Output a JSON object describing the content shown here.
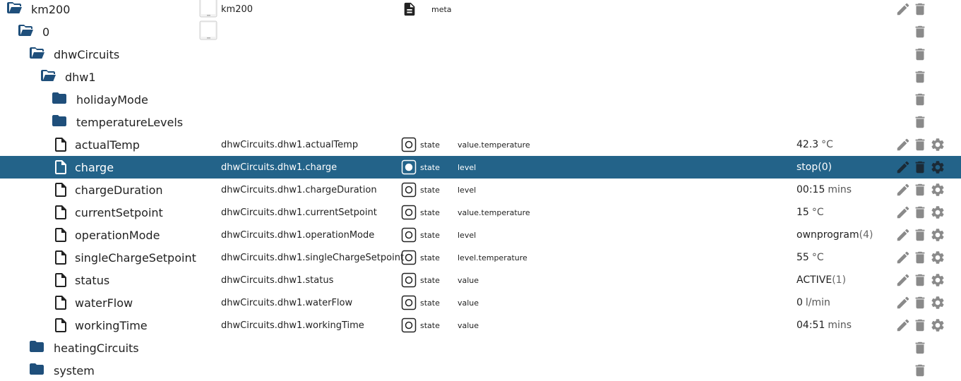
{
  "colors": {
    "folder": "#1f4f7b",
    "selected_bg": "#236389",
    "action_icon": "#8a8a8a"
  },
  "icons": {
    "folder_open": "folder-open-icon",
    "folder_closed": "folder-icon",
    "state": "file-icon",
    "edit": "pencil-icon",
    "delete": "trash-icon",
    "settings": "gear-icon",
    "meta": "document-icon"
  },
  "rows": [
    {
      "name": "km200",
      "kind": "folder-open",
      "id": "km200",
      "type": "meta",
      "role": "",
      "value": "",
      "unit": "",
      "code": ""
    },
    {
      "name": "0",
      "kind": "folder-open",
      "id": "",
      "type": "",
      "role": "",
      "value": "",
      "unit": "",
      "code": ""
    },
    {
      "name": "dhwCircuits",
      "kind": "folder-open",
      "id": "",
      "type": "",
      "role": "",
      "value": "",
      "unit": "",
      "code": ""
    },
    {
      "name": "dhw1",
      "kind": "folder-open",
      "id": "",
      "type": "",
      "role": "",
      "value": "",
      "unit": "",
      "code": ""
    },
    {
      "name": "holidayMode",
      "kind": "folder",
      "id": "",
      "type": "",
      "role": "",
      "value": "",
      "unit": "",
      "code": ""
    },
    {
      "name": "temperatureLevels",
      "kind": "folder",
      "id": "",
      "type": "",
      "role": "",
      "value": "",
      "unit": "",
      "code": ""
    },
    {
      "name": "actualTemp",
      "kind": "state",
      "id": "dhwCircuits.dhw1.actualTemp",
      "type": "state",
      "role": "value.temperature",
      "value": "42.3",
      "unit": "°C",
      "code": ""
    },
    {
      "name": "charge",
      "kind": "state",
      "id": "dhwCircuits.dhw1.charge",
      "type": "state",
      "role": "level",
      "value": "stop",
      "unit": "",
      "code": "(0)"
    },
    {
      "name": "chargeDuration",
      "kind": "state",
      "id": "dhwCircuits.dhw1.chargeDuration",
      "type": "state",
      "role": "level",
      "value": "00:15",
      "unit": "mins",
      "code": ""
    },
    {
      "name": "currentSetpoint",
      "kind": "state",
      "id": "dhwCircuits.dhw1.currentSetpoint",
      "type": "state",
      "role": "value.temperature",
      "value": "15",
      "unit": "°C",
      "code": ""
    },
    {
      "name": "operationMode",
      "kind": "state",
      "id": "dhwCircuits.dhw1.operationMode",
      "type": "state",
      "role": "level",
      "value": "ownprogram",
      "unit": "",
      "code": "(4)"
    },
    {
      "name": "singleChargeSetpoint",
      "kind": "state",
      "id": "dhwCircuits.dhw1.singleChargeSetpoint",
      "type": "state",
      "role": "level.temperature",
      "value": "55",
      "unit": "°C",
      "code": ""
    },
    {
      "name": "status",
      "kind": "state",
      "id": "dhwCircuits.dhw1.status",
      "type": "state",
      "role": "value",
      "value": "ACTIVE",
      "unit": "",
      "code": "(1)"
    },
    {
      "name": "waterFlow",
      "kind": "state",
      "id": "dhwCircuits.dhw1.waterFlow",
      "type": "state",
      "role": "value",
      "value": "0",
      "unit": "l/min",
      "code": ""
    },
    {
      "name": "workingTime",
      "kind": "state",
      "id": "dhwCircuits.dhw1.workingTime",
      "type": "state",
      "role": "value",
      "value": "04:51",
      "unit": "mins",
      "code": ""
    },
    {
      "name": "heatingCircuits",
      "kind": "folder",
      "id": "",
      "type": "",
      "role": "",
      "value": "",
      "unit": "",
      "code": ""
    },
    {
      "name": "system",
      "kind": "folder",
      "id": "",
      "type": "",
      "role": "",
      "value": "",
      "unit": "",
      "code": ""
    }
  ]
}
